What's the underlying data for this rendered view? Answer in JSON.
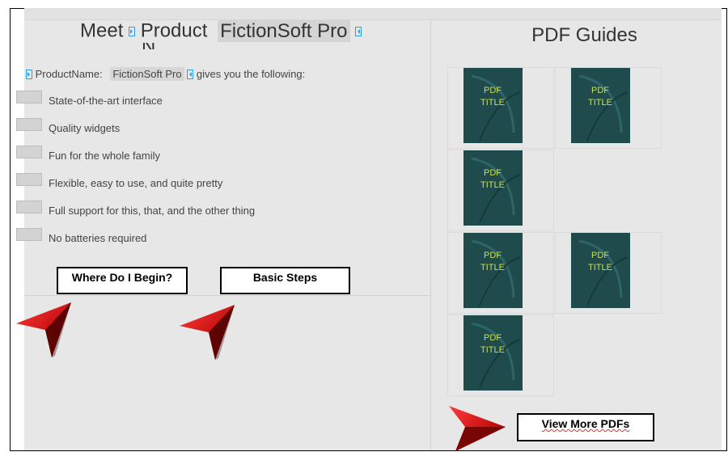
{
  "title": {
    "prefix": "Meet",
    "product_field_label": "Product",
    "product_field_overflow": "N",
    "product_name": "FictionSoft Pro"
  },
  "intro": {
    "field_label": "ProductName:",
    "product_name": "FictionSoft Pro",
    "suffix": "gives you the following:"
  },
  "features": [
    "State-of-the-art interface",
    "Quality widgets",
    "Fun for the whole family",
    "Flexible, easy to use, and quite pretty",
    "Full support for this, that, and the other thing",
    "No batteries required"
  ],
  "buttons": {
    "where_begin": "Where Do I Begin?",
    "basic_steps": "Basic Steps",
    "view_more_pdfs": "View More PDFs"
  },
  "pdf_guides": {
    "heading": "PDF Guides",
    "cover_line1": "PDF",
    "cover_line2": "TITLE"
  },
  "colors": {
    "cover_bg": "#1f4b4d",
    "cover_text": "#c9e04a",
    "arrow_red": "#c40f0f",
    "marker_blue": "#2aa0e6"
  }
}
